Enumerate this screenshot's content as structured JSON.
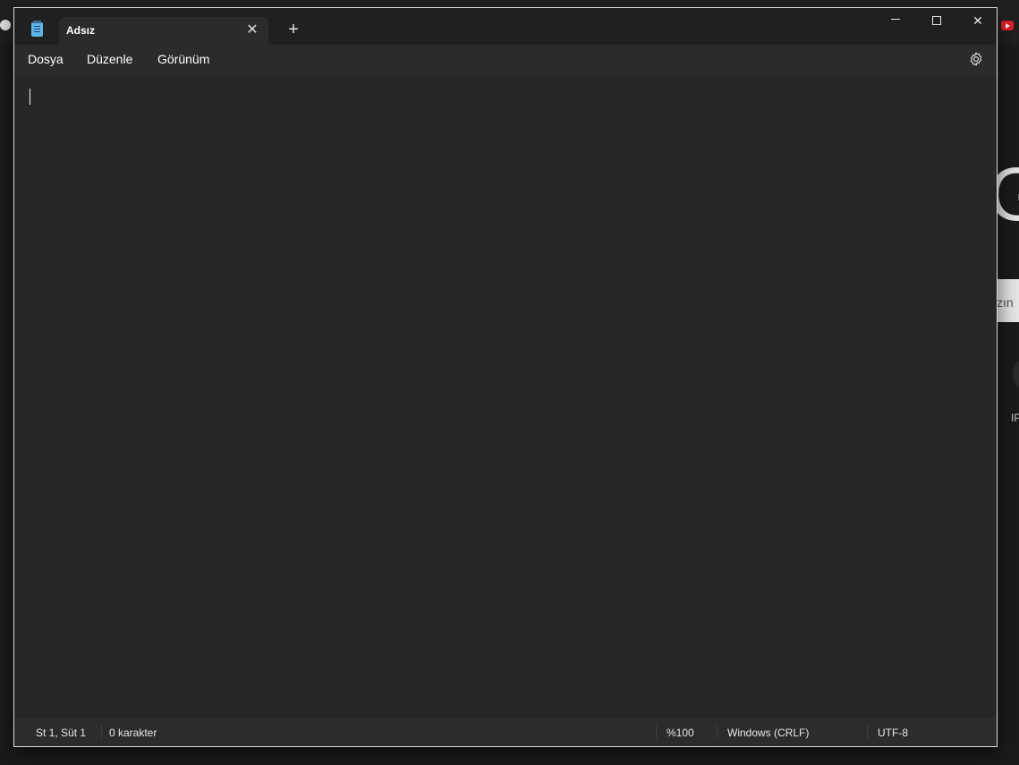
{
  "background": {
    "partial_search_text": "zın",
    "partial_shortcut_label": "IP",
    "google_letter": "G"
  },
  "titlebar": {
    "tab_title": "Adsız",
    "tab_close_glyph": "✕",
    "new_tab_glyph": "+",
    "close_glyph": "✕"
  },
  "menu": {
    "file": "Dosya",
    "edit": "Düzenle",
    "view": "Görünüm"
  },
  "editor": {
    "content": ""
  },
  "status": {
    "position": "St 1, Süt 1",
    "characters": "0 karakter",
    "zoom": "%100",
    "line_ending": "Windows (CRLF)",
    "encoding": "UTF-8"
  },
  "colors": {
    "window_bg": "#272727",
    "titlebar_bg": "#202020",
    "tab_bg": "#2b2b2b",
    "statusbar_bg": "#2c2c2c",
    "accent_icon": "#5fb3e8"
  },
  "icons": {
    "app": "notepad-icon",
    "settings": "gear-icon",
    "minimize": "minimize-icon",
    "maximize": "maximize-icon",
    "close": "close-icon"
  }
}
